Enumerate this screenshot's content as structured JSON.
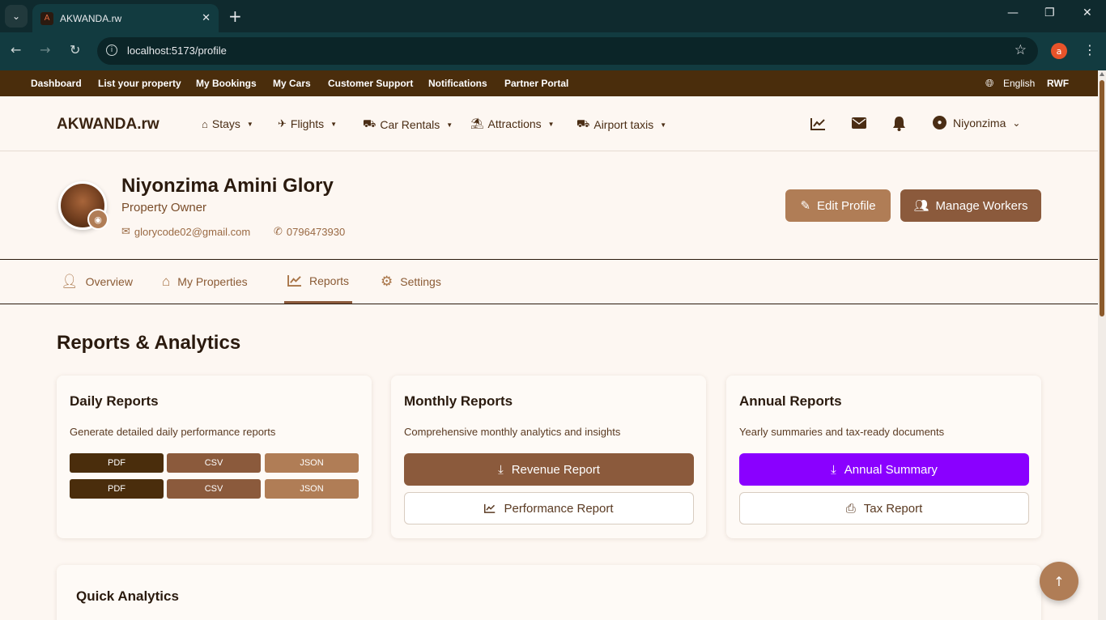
{
  "browser": {
    "tab_title": "AKWANDA.rw",
    "url_host": "localhost",
    "url_path": ":5173/profile",
    "profile_initial": "a"
  },
  "topnav": {
    "items": [
      "Dashboard",
      "List your property",
      "My Bookings",
      "My Cars",
      "Customer Support",
      "Notifications",
      "Partner Portal"
    ],
    "language": "English",
    "currency": "RWF"
  },
  "header": {
    "brand": "AKWANDA.rw",
    "nav": [
      "Stays",
      "Flights",
      "Car Rentals",
      "Attractions",
      "Airport taxis"
    ],
    "user_name": "Niyonzima"
  },
  "profile": {
    "name": "Niyonzima Amini Glory",
    "role": "Property Owner",
    "email": "glorycode02@gmail.com",
    "phone": "0796473930",
    "edit_label": "Edit Profile",
    "workers_label": "Manage Workers"
  },
  "tabs": [
    {
      "label": "Overview"
    },
    {
      "label": "My Properties"
    },
    {
      "label": "Reports"
    },
    {
      "label": "Settings"
    }
  ],
  "active_tab": "Reports",
  "reports": {
    "title": "Reports & Analytics",
    "daily": {
      "title": "Daily Reports",
      "desc": "Generate detailed daily performance reports",
      "formats": [
        "PDF",
        "CSV",
        "JSON"
      ]
    },
    "monthly": {
      "title": "Monthly Reports",
      "desc": "Comprehensive monthly analytics and insights",
      "primary": "Revenue Report",
      "secondary": "Performance Report"
    },
    "annual": {
      "title": "Annual Reports",
      "desc": "Yearly summaries and tax-ready documents",
      "primary": "Annual Summary",
      "secondary": "Tax Report"
    }
  },
  "quick_analytics": {
    "title": "Quick Analytics"
  },
  "colors": {
    "topnav_bg": "#4a2d0c",
    "accent_brown": "#8b5a3c",
    "light_brown": "#b07d56",
    "annual_purple": "#8a00ff",
    "page_bg": "#fdf7f2"
  },
  "icons": [
    "home-icon",
    "plane-icon",
    "car-icon",
    "umbrella-beach-icon",
    "taxi-icon",
    "chart-icon",
    "envelope-icon",
    "bell-icon",
    "user-circle-icon",
    "camera-icon",
    "edit-icon",
    "users-icon",
    "download-icon",
    "print-icon",
    "gear-icon",
    "arrow-up-icon"
  ]
}
